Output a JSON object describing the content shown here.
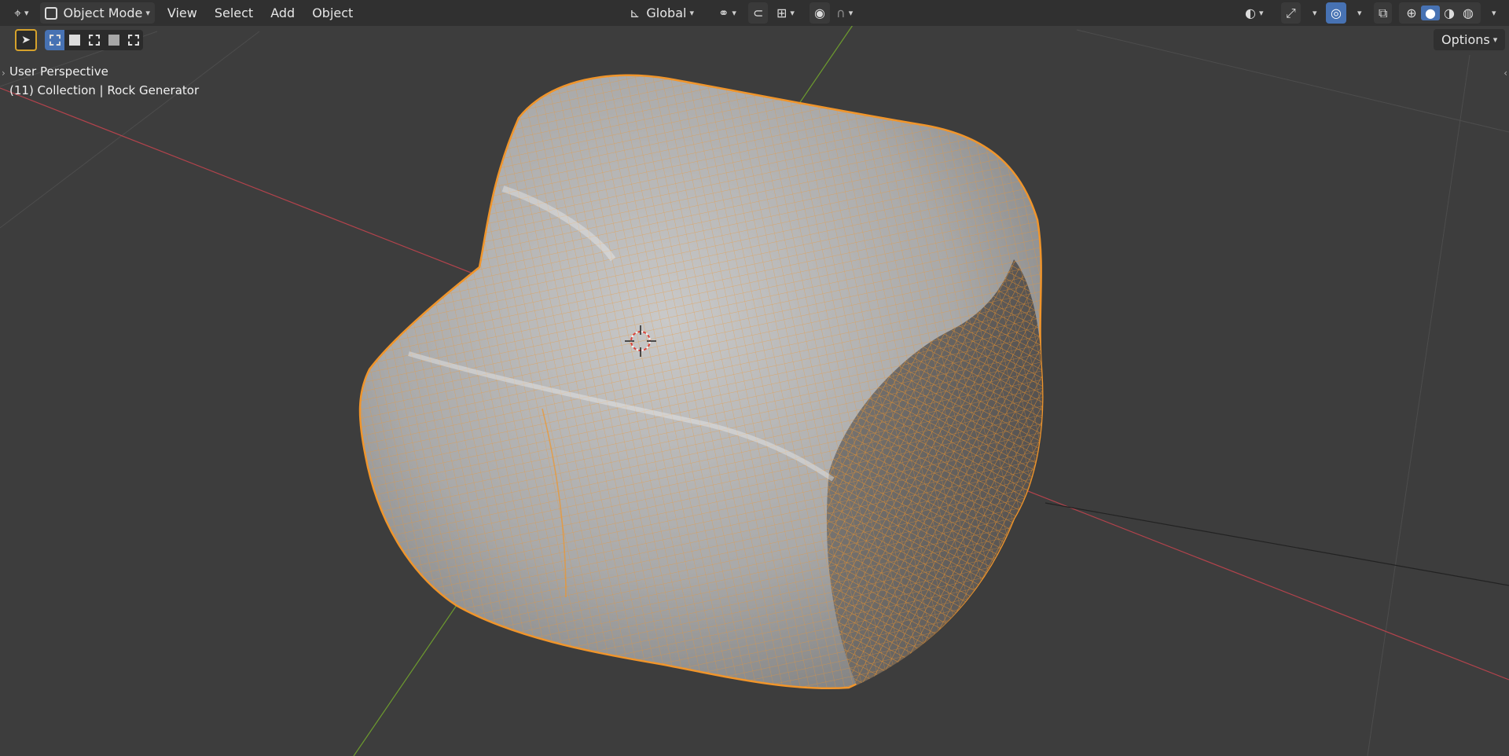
{
  "header": {
    "editor_type_icon": "view3d-icon",
    "mode_label": "Object Mode",
    "menu": [
      "View",
      "Select",
      "Add",
      "Object"
    ],
    "transform_orientation": "Global",
    "icons": {
      "pivot": "pivot-icon",
      "snap": "snap-icon",
      "snap_increment": "snap-increment-icon",
      "proportional": "proportional-edit-icon",
      "falloff": "falloff-curve-icon",
      "visibility": "visibility-eye-icon",
      "gizmo": "gizmo-icon",
      "overlay": "overlay-icon",
      "xray": "xray-icon",
      "shading_wire": "wireframe-shading-icon",
      "shading_solid": "solid-shading-icon",
      "shading_material": "material-shading-icon",
      "shading_render": "rendered-shading-icon"
    }
  },
  "toolbar": {
    "options_label": "Options",
    "select_tool_icon": "cursor-select-icon",
    "active_select_mode": 0
  },
  "viewport": {
    "perspective_label": "User Perspective",
    "object_info": "(11) Collection | Rock Generator"
  },
  "colors": {
    "background": "#3d3d3d",
    "header": "#303030",
    "accent": "#4772b3",
    "selection_outline": "#f0952b",
    "x_axis": "#b2434c",
    "y_axis": "#6d9b2e",
    "grid": "#4a4a4a"
  }
}
